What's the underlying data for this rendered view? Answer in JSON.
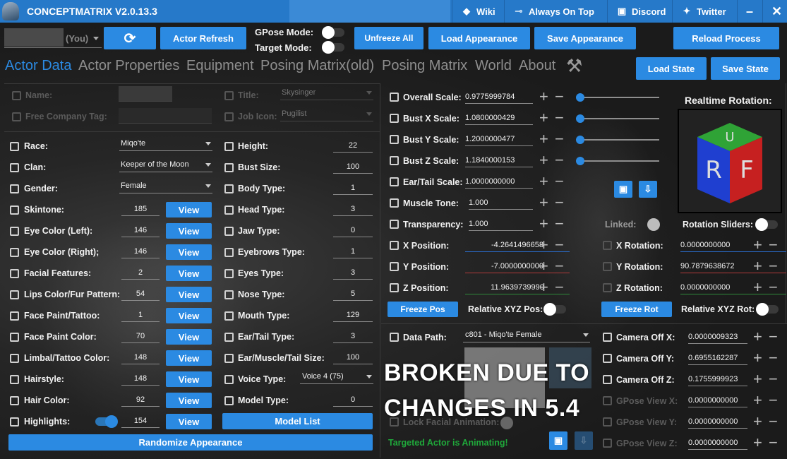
{
  "title": {
    "app": "CONCEPTMATRIX V2.0.13.3"
  },
  "nav": [
    {
      "label": "Wiki",
      "icon": "diamond-icon"
    },
    {
      "label": "Always On Top",
      "icon": "pin-icon"
    },
    {
      "label": "Discord",
      "icon": "discord-icon"
    },
    {
      "label": "Twitter",
      "icon": "twitter-icon"
    }
  ],
  "toolbar": {
    "actor_select": "(You)",
    "actor_refresh": "Actor Refresh",
    "gpose_mode": "GPose Mode:",
    "target_mode": "Target Mode:",
    "unfreeze_all": "Unfreeze All",
    "load_appearance": "Load Appearance",
    "save_appearance": "Save Appearance",
    "reload_process": "Reload Process",
    "load_state": "Load State",
    "save_state": "Save State"
  },
  "tabs": [
    "Actor Data",
    "Actor Properties",
    "Equipment",
    "Posing Matrix(old)",
    "Posing Matrix",
    "World",
    "About"
  ],
  "top": {
    "name_label": "Name:",
    "fc_label": "Free Company Tag:",
    "title_label": "Title:",
    "title_value": "Skysinger",
    "job_label": "Job Icon:",
    "job_value": "Pugilist"
  },
  "left": [
    {
      "label": "Race:",
      "value": "Miqo'te",
      "kind": "dd"
    },
    {
      "label": "Clan:",
      "value": "Keeper of the Moon",
      "kind": "dd"
    },
    {
      "label": "Gender:",
      "value": "Female",
      "kind": "dd"
    },
    {
      "label": "Skintone:",
      "value": "185",
      "kind": "view"
    },
    {
      "label": "Eye Color (Left):",
      "value": "146",
      "kind": "view"
    },
    {
      "label": "Eye Color (Right);",
      "value": "146",
      "kind": "view"
    },
    {
      "label": "Facial Features:",
      "value": "2",
      "kind": "view"
    },
    {
      "label": "Lips Color/Fur Pattern:",
      "value": "54",
      "kind": "view"
    },
    {
      "label": "Face Paint/Tattoo:",
      "value": "1",
      "kind": "view"
    },
    {
      "label": "Face Paint Color:",
      "value": "70",
      "kind": "view"
    },
    {
      "label": "Limbal/Tattoo Color:",
      "value": "148",
      "kind": "view"
    },
    {
      "label": "Hairstyle:",
      "value": "148",
      "kind": "view"
    },
    {
      "label": "Hair Color:",
      "value": "92",
      "kind": "view"
    },
    {
      "label": "Highlights:",
      "value": "154",
      "kind": "view"
    }
  ],
  "view_label": "View",
  "mid": [
    {
      "label": "Height:",
      "value": "22"
    },
    {
      "label": "Bust Size:",
      "value": "100"
    },
    {
      "label": "Body Type:",
      "value": "1"
    },
    {
      "label": "Head Type:",
      "value": "3"
    },
    {
      "label": "Jaw Type:",
      "value": "0"
    },
    {
      "label": "Eyebrows Type:",
      "value": "1"
    },
    {
      "label": "Eyes Type:",
      "value": "3"
    },
    {
      "label": "Nose Type:",
      "value": "5"
    },
    {
      "label": "Mouth Type:",
      "value": "129"
    },
    {
      "label": "Ear/Tail Type:",
      "value": "3"
    },
    {
      "label": "Ear/Muscle/Tail Size:",
      "value": "100"
    },
    {
      "label": "Voice Type:",
      "value": "Voice 4 (75)"
    },
    {
      "label": "Model Type:",
      "value": "0"
    }
  ],
  "model_list": "Model List",
  "randomize": "Randomize Appearance",
  "scale": [
    {
      "label": "Overall Scale:",
      "value": "0.9775999784"
    },
    {
      "label": "Bust X Scale:",
      "value": "1.0800000429"
    },
    {
      "label": "Bust Y Scale:",
      "value": "1.2000000477"
    },
    {
      "label": "Bust Z Scale:",
      "value": "1.1840000153"
    },
    {
      "label": "Ear/Tail Scale:",
      "value": "1.0000000000"
    },
    {
      "label": "Muscle Tone:",
      "value": "1.000"
    },
    {
      "label": "Transparency:",
      "value": "1.000"
    },
    {
      "label": "X Position:",
      "value": "-4.2641496658"
    },
    {
      "label": "Y Position:",
      "value": "-7.0000000000"
    },
    {
      "label": "Z Position:",
      "value": "11.9639739990"
    }
  ],
  "freeze_pos": "Freeze Pos",
  "relative_xyz_pos": "Relative XYZ Pos:",
  "realtime_rotation": "Realtime Rotation:",
  "cube": {
    "r": "R",
    "f": "F",
    "u": "U"
  },
  "linked": "Linked:",
  "rotation_sliders": "Rotation Sliders:",
  "rotation": [
    {
      "label": "X Rotation:",
      "value": "0.0000000000"
    },
    {
      "label": "Y Rotation:",
      "value": "90.7879638672"
    },
    {
      "label": "Z Rotation:",
      "value": "0.0000000000"
    }
  ],
  "freeze_rot": "Freeze Rot",
  "relative_xyz_rot": "Relative XYZ Rot:",
  "data_path": {
    "label": "Data Path:",
    "value": "c801 - Miqo'te Female"
  },
  "lock_facial": "Lock Facial Animation:",
  "animating": "Targeted Actor is Animating!",
  "overlay_text": [
    "BROKEN DUE TO",
    "CHANGES IN 5.4"
  ],
  "camera": [
    {
      "label": "Camera Off X:",
      "value": "0.0000009323",
      "dim": false
    },
    {
      "label": "Camera Off Y:",
      "value": "0.6955162287",
      "dim": false
    },
    {
      "label": "Camera Off Z:",
      "value": "0.1755999923",
      "dim": false
    },
    {
      "label": "GPose View X:",
      "value": "0.0000000000",
      "dim": true
    },
    {
      "label": "GPose View Y:",
      "value": "0.0000000000",
      "dim": true
    },
    {
      "label": "GPose View Z:",
      "value": "0.0000000000",
      "dim": true
    }
  ],
  "colors": {
    "accent": "#2b8ae2",
    "titlebar": "#2679c9",
    "success": "#1fa83a"
  }
}
